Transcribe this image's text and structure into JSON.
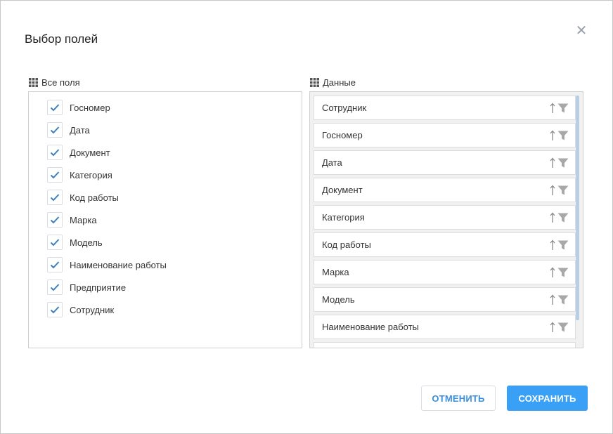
{
  "dialog": {
    "title": "Выбор полей",
    "close_icon": "close-icon"
  },
  "all_fields": {
    "title": "Все поля",
    "icon": "grid-icon",
    "items": [
      {
        "label": "Госномер",
        "checked": true
      },
      {
        "label": "Дата",
        "checked": true
      },
      {
        "label": "Документ",
        "checked": true
      },
      {
        "label": "Категория",
        "checked": true
      },
      {
        "label": "Код работы",
        "checked": true
      },
      {
        "label": "Марка",
        "checked": true
      },
      {
        "label": "Модель",
        "checked": true
      },
      {
        "label": "Наименование работы",
        "checked": true
      },
      {
        "label": "Предприятие",
        "checked": true
      },
      {
        "label": "Сотрудник",
        "checked": true
      }
    ]
  },
  "data_fields": {
    "title": "Данные",
    "icon": "grid-icon",
    "items": [
      {
        "label": "Сотрудник"
      },
      {
        "label": "Госномер"
      },
      {
        "label": "Дата"
      },
      {
        "label": "Документ"
      },
      {
        "label": "Категория"
      },
      {
        "label": "Код работы"
      },
      {
        "label": "Марка"
      },
      {
        "label": "Модель"
      },
      {
        "label": "Наименование работы"
      }
    ]
  },
  "buttons": {
    "cancel_label": "ОТМЕНИТЬ",
    "save_label": "СОХРАНИТЬ"
  },
  "colors": {
    "accent": "#3aa0f5",
    "check": "#3a7fc2",
    "scrollbar": "#b9cfe4",
    "close": "#9aa3ad"
  }
}
